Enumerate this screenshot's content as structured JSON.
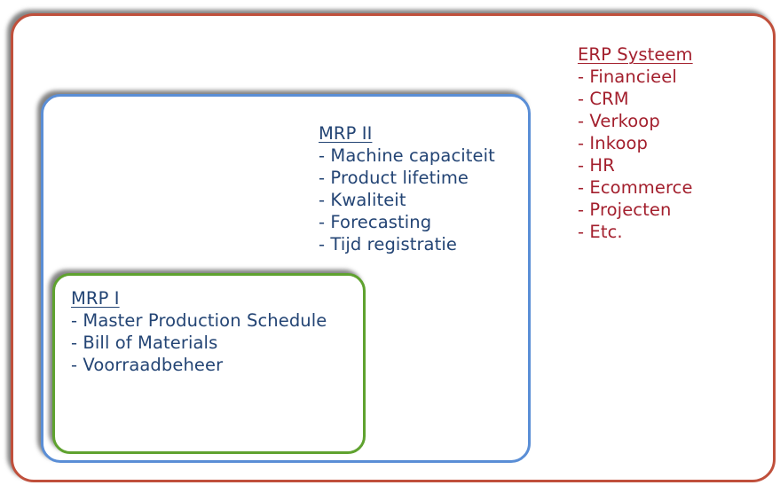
{
  "diagram": {
    "erp": {
      "title": "ERP Systeem",
      "items": [
        "- Financieel",
        "- CRM",
        "- Verkoop",
        "- Inkoop",
        "- HR",
        "- Ecommerce",
        "- Projecten",
        "- Etc."
      ],
      "border_color": "#C0503C",
      "text_color": "#A31F2D"
    },
    "mrp2": {
      "title": "MRP II",
      "items": [
        "- Machine capaciteit",
        "- Product lifetime",
        "- Kwaliteit",
        "- Forecasting",
        "- Tijd registratie"
      ],
      "border_color": "#5A8ED6",
      "text_color": "#234474"
    },
    "mrp1": {
      "title": "MRP I",
      "items": [
        "- Master Production Schedule",
        "- Bill of Materials",
        "- Voorraadbeheer"
      ],
      "border_color": "#5FA22F",
      "text_color": "#234474"
    }
  }
}
